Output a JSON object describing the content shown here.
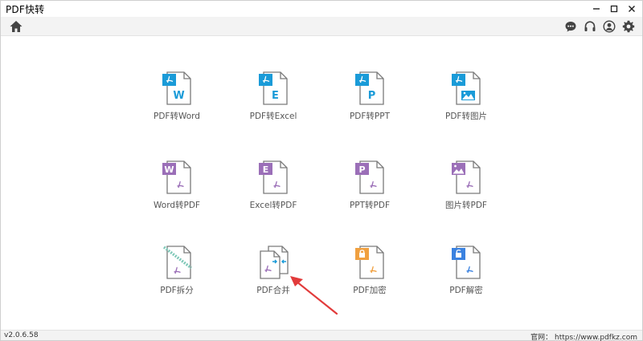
{
  "app": {
    "title": "PDF快转"
  },
  "window": {
    "minimize": "–",
    "maximize": "□",
    "close": "✕"
  },
  "toolbar": {
    "home_icon": "home-icon",
    "right_icons": [
      "chat-icon",
      "headset-icon",
      "user-icon",
      "gear-icon"
    ]
  },
  "tiles": [
    {
      "label": "PDF转Word",
      "icon": "pdf-to-word",
      "badge": "W",
      "color": "#1a9bd8"
    },
    {
      "label": "PDF转Excel",
      "icon": "pdf-to-excel",
      "badge": "E",
      "color": "#1a9bd8"
    },
    {
      "label": "PDF转PPT",
      "icon": "pdf-to-ppt",
      "badge": "P",
      "color": "#1a9bd8"
    },
    {
      "label": "PDF转图片",
      "icon": "pdf-to-image",
      "badge": "",
      "color": "#1a9bd8"
    },
    {
      "label": "Word转PDF",
      "icon": "word-to-pdf",
      "badge": "W",
      "color": "#9b6fb8"
    },
    {
      "label": "Excel转PDF",
      "icon": "excel-to-pdf",
      "badge": "E",
      "color": "#9b6fb8"
    },
    {
      "label": "PPT转PDF",
      "icon": "ppt-to-pdf",
      "badge": "P",
      "color": "#9b6fb8"
    },
    {
      "label": "图片转PDF",
      "icon": "image-to-pdf",
      "badge": "",
      "color": "#9b6fb8"
    },
    {
      "label": "PDF拆分",
      "icon": "pdf-split",
      "badge": "",
      "color": "#7fc8b8"
    },
    {
      "label": "PDF合并",
      "icon": "pdf-merge",
      "badge": "",
      "color": "#1a9bd8"
    },
    {
      "label": "PDF加密",
      "icon": "pdf-encrypt",
      "badge": "",
      "color": "#f0a040"
    },
    {
      "label": "PDF解密",
      "icon": "pdf-decrypt",
      "badge": "",
      "color": "#3b82e0"
    }
  ],
  "status": {
    "version": "v2.0.6.58",
    "website": "官网：  https://www.pdfkz.com"
  },
  "colors": {
    "pdf_red": "#9b6fb8",
    "annotation_arrow": "#e23b3b"
  }
}
